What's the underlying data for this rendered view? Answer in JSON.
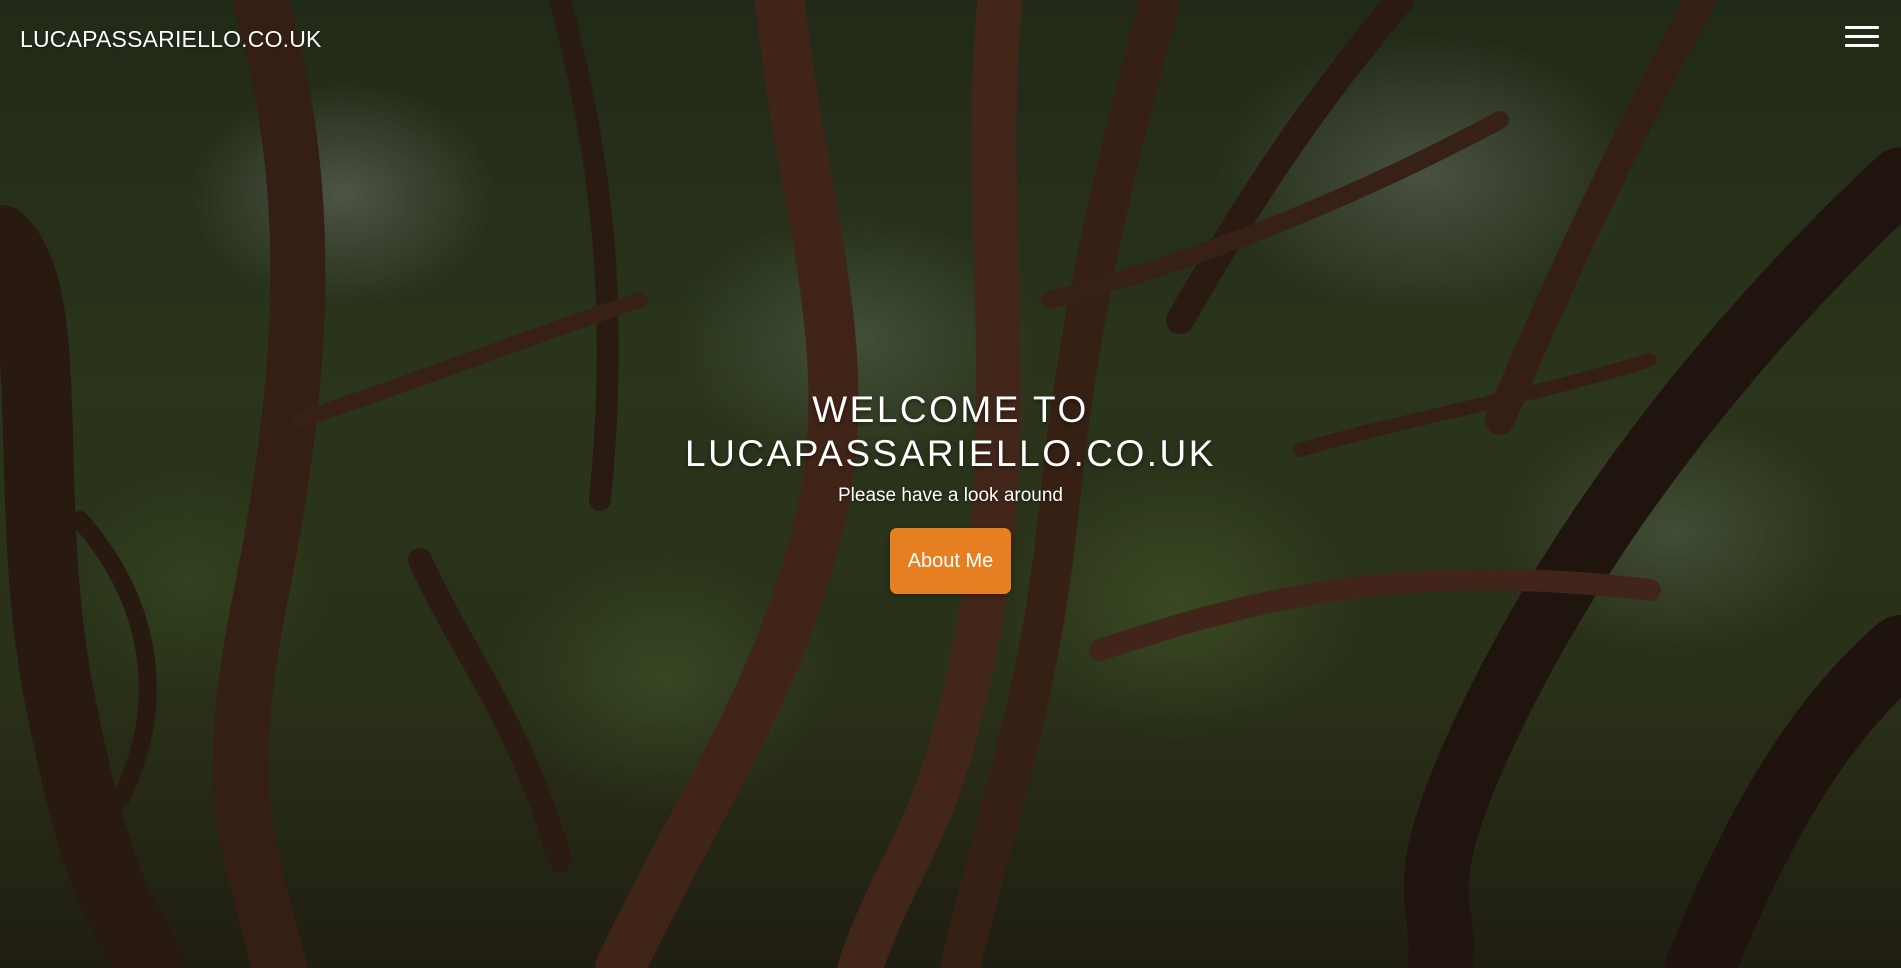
{
  "navbar": {
    "brand": "LUCAPASSARIELLO.CO.UK",
    "menu_icon": "hamburger-menu-icon"
  },
  "hero": {
    "title_line1": "WELCOME TO",
    "title_line2": "LUCAPASSARIELLO.CO.UK",
    "subtitle": "Please have a look around",
    "cta_label": "About Me"
  },
  "colors": {
    "accent": "#e67e22",
    "text": "#ffffff"
  }
}
